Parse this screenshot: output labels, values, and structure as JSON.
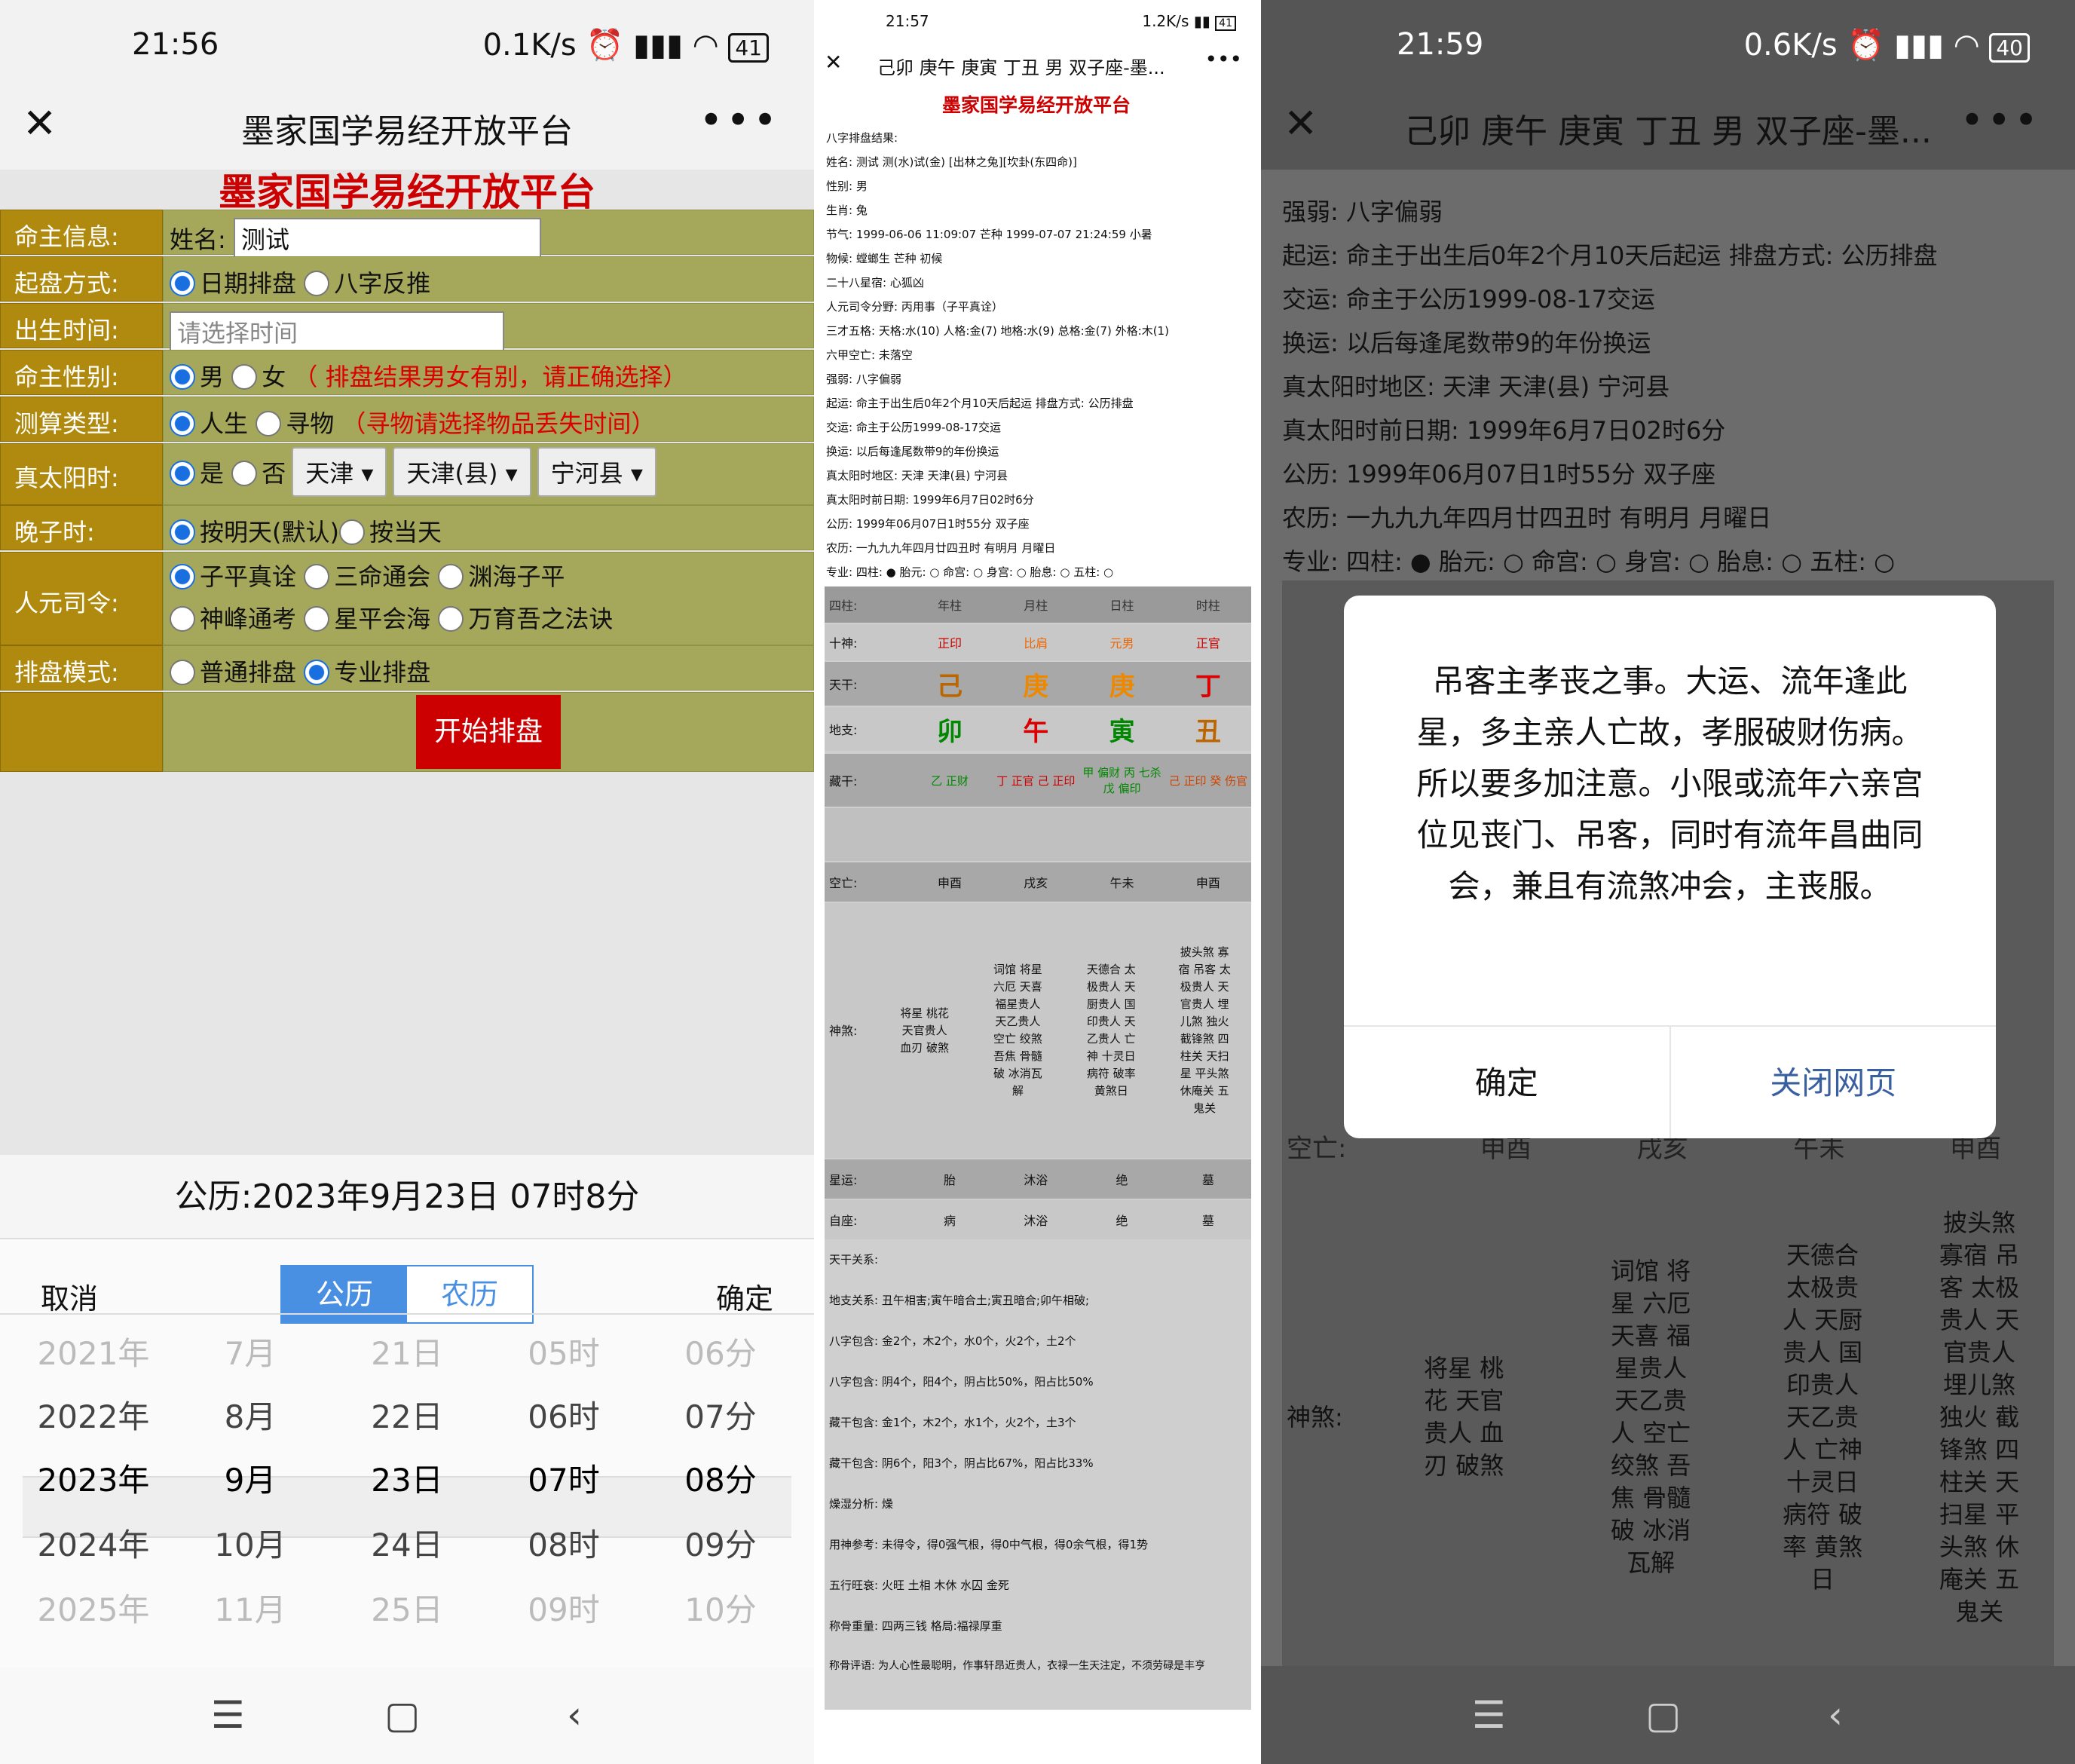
{
  "p1": {
    "time": "21:56",
    "net": "0.1K/s",
    "battery": "41",
    "nav_title": "墨家国学易经开放平台",
    "page_title": "墨家国学易经开放平台",
    "rows": {
      "name": {
        "label": "命主信息:",
        "prefix": "姓名:",
        "value": "测试"
      },
      "mode": {
        "label": "起盘方式:",
        "opt1": "日期排盘",
        "opt2": "八字反推"
      },
      "birth": {
        "label": "出生时间:",
        "placeholder": "请选择时间"
      },
      "gender": {
        "label": "命主性别:",
        "opt1": "男",
        "opt2": "女",
        "note": "（ 排盘结果男女有别，请正确选择）"
      },
      "type": {
        "label": "测算类型:",
        "opt1": "人生",
        "opt2": "寻物",
        "note": "（寻物请选择物品丢失时间）"
      },
      "solar": {
        "label": "真太阳时:",
        "opt1": "是",
        "opt2": "否",
        "sel1": "天津",
        "sel2": "天津(县)",
        "sel3": "宁河县"
      },
      "late": {
        "label": "晚子时:",
        "opt1": "按明天(默认)",
        "opt2": "按当天"
      },
      "renyuan": {
        "label": "人元司令:",
        "opt1": "子平真诠",
        "opt2": "三命通会",
        "opt3": "渊海子平",
        "opt4": "神峰通考",
        "opt5": "星平会海",
        "opt6": "万育吾之法诀"
      },
      "layout": {
        "label": "排盘模式:",
        "opt1": "普通排盘",
        "opt2": "专业排盘"
      }
    },
    "start_button": "开始排盘",
    "picker": {
      "header": "公历:2023年9月23日 07时8分",
      "cancel": "取消",
      "confirm": "确定",
      "tab_solar": "公历",
      "tab_lunar": "农历",
      "rows": [
        [
          "2021年",
          "7月",
          "21日",
          "05时",
          "06分"
        ],
        [
          "2022年",
          "8月",
          "22日",
          "06时",
          "07分"
        ],
        [
          "2023年",
          "9月",
          "23日",
          "07时",
          "08分"
        ],
        [
          "2024年",
          "10月",
          "24日",
          "08时",
          "09分"
        ],
        [
          "2025年",
          "11月",
          "25日",
          "09时",
          "10分"
        ]
      ]
    }
  },
  "p2": {
    "time": "21:57",
    "net": "1.2K/s",
    "battery": "41",
    "nav_title": "己卯 庚午 庚寅 丁丑 男 双子座-墨...",
    "page_title": "墨家国学易经开放平台",
    "lines": [
      "八字排盘结果:",
      "姓名: 测试 测(水)试(金) [出林之兔][坎卦(东四命)]",
      "性别: 男",
      "生肖: 兔",
      "节气: 1999-06-06 11:09:07 芒种 1999-07-07 21:24:59 小暑",
      "物候: 螳螂生 芒种 初候",
      "二十八星宿: 心狐凶",
      "人元司令分野: 丙用事（子平真诠）",
      "三才五格: 天格:水(10) 人格:金(7) 地格:水(9) 总格:金(7) 外格:木(1)",
      "六甲空亡: 未落空",
      "强弱: 八字偏弱",
      "起运: 命主于出生后0年2个月10天后起运 排盘方式: 公历排盘",
      "交运: 命主于公历1999-08-17交运",
      "换运: 以后每逢尾数带9的年份换运",
      "真太阳时地区: 天津 天津(县) 宁河县",
      "真太阳时前日期: 1999年6月7日02时6分",
      "公历: 1999年06月07日1时55分 双子座",
      "农历: 一九九九年四月廿四丑时 有明月 月曜日",
      "专业: 四柱: ● 胎元: ○ 命宫: ○ 身宫: ○ 胎息: ○ 五柱: ○"
    ],
    "table_head": [
      "四柱:",
      "年柱",
      "月柱",
      "日柱",
      "时柱"
    ],
    "shishen": [
      "十神:",
      "正印",
      "比肩",
      "元男",
      "正官"
    ],
    "tiangan": [
      "天干:",
      "己",
      "庚",
      "庚",
      "丁"
    ],
    "dizhi": [
      "地支:",
      "卯",
      "午",
      "寅",
      "丑"
    ],
    "canggan": [
      "藏干:",
      "乙 正财",
      "丁 正官 己 正印",
      "甲 偏财 丙 七杀 戊 偏印",
      "己 正印 癸 伤官"
    ],
    "kongwang": [
      "空亡:",
      "申酉",
      "戌亥",
      "午未",
      "申酉"
    ],
    "shensha_label": "神煞:",
    "shensha": [
      "将星 桃花 天官贵人 血刃 破煞",
      "词馆 将星 六厄 天喜 福星贵人 天乙贵人 空亡 绞煞 吾焦 骨髓破 冰消瓦解",
      "天德合 太极贵人 天厨贵人 国印贵人 天乙贵人 亡神 十灵日 病符 破率 黄煞日",
      "披头煞 寡宿 吊客 太极贵人 天官贵人 埋儿煞 独火 截锋煞 四柱关 天扫星 平头煞 休庵关 五鬼关"
    ],
    "xingyun": [
      "星运:",
      "胎",
      "沐浴",
      "绝",
      "墓"
    ],
    "zizuo": [
      "自座:",
      "病",
      "沐浴",
      "绝",
      "墓"
    ],
    "bottom": [
      "天干关系:",
      "地支关系: 丑午相害;寅午暗合土;寅丑暗合;卯午相破;",
      "八字包含: 金2个，木2个，水0个，火2个，土2个",
      "八字包含: 阴4个，阳4个，阴占比50%，阳占比50%",
      "藏干包含: 金1个，木2个，水1个，火2个，土3个",
      "藏干包含: 阴6个，阳3个，阴占比67%，阳占比33%",
      "燥湿分析: 燥",
      "用神参考: 未得令，得0强气根，得0中气根，得0余气根，得1势",
      "五行旺衰: 火旺 土相 木休 水囚 金死",
      "称骨重量: 四两三钱 格局:福禄厚重",
      "称骨评语: 为人心性最聪明，作事轩昂近贵人，衣禄一生天注定，不须劳碌是丰亨"
    ]
  },
  "p3": {
    "time": "21:59",
    "net": "0.6K/s",
    "battery": "40",
    "nav_title": "己卯 庚午 庚寅 丁丑 男 双子座-墨...",
    "lines": [
      "强弱: 八字偏弱",
      "起运: 命主于出生后0年2个月10天后起运 排盘方式: 公历排盘",
      "交运: 命主于公历1999-08-17交运",
      "换运: 以后每逢尾数带9的年份换运",
      "真太阳时地区: 天津 天津(县) 宁河县",
      "真太阳时前日期: 1999年6月7日02时6分",
      "公历: 1999年06月07日1时55分 双子座",
      "农历: 一九九九年四月廿四丑时 有明月 月曜日",
      "专业: 四柱: ● 胎元: ○ 命宫: ○ 身宫: ○ 胎息: ○ 五柱: ○"
    ],
    "modal_msg": "吊客主孝丧之事。大运、流年逢此星，多主亲人亡故，孝服破财伤病。所以要多加注意。小限或流年六亲宫位见丧门、吊客，同时有流年昌曲同会，兼且有流煞冲会，主丧服。",
    "modal_ok": "确定",
    "modal_close": "关闭网页",
    "kongwang": [
      "空亡:",
      "申酉",
      "戌亥",
      "午未",
      "申酉"
    ],
    "shensha_label": "神煞:",
    "shensha": [
      "将星 桃花 天官贵人 血刃 破煞",
      "词馆 将星 六厄 天喜 福星贵人 天乙贵人 空亡 绞煞 吾焦 骨髓破 冰消瓦解",
      "天德合 太极贵人 天厨贵人 国印贵人 天乙贵人 亡神 十灵日 病符 破率 黄煞日",
      "披头煞 寡宿 吊客 太极贵人 天官贵人 埋儿煞 独火 截锋煞 四柱关 天扫星 平头煞 休庵关 五鬼关"
    ]
  },
  "sys_nav": {
    "menu": "☰",
    "home": "▢",
    "back": "‹"
  }
}
